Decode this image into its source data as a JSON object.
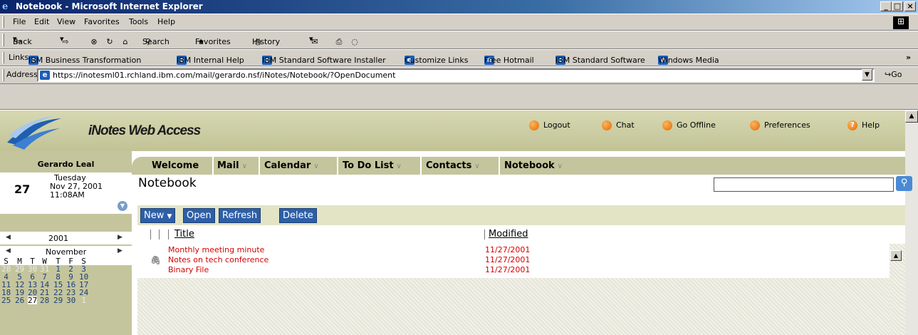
{
  "window": {
    "title": "Notebook - Microsoft Internet Explorer",
    "controls": [
      "_",
      "□",
      "×"
    ]
  },
  "menu": [
    "File",
    "Edit",
    "View",
    "Favorites",
    "Tools",
    "Help"
  ],
  "toolbar": {
    "back": "Back",
    "search": "Search",
    "favorites": "Favorites",
    "history": "History"
  },
  "links": {
    "label": "Links",
    "items": [
      "IBM Business Transformation",
      "IBM Internal Help",
      "IBM Standard Software Installer",
      "Customize Links",
      "Free Hotmail",
      "IBM Standard Software",
      "Windows Media"
    ],
    "more": "»"
  },
  "address": {
    "label": "Address",
    "url": "https://inotesml01.rchland.ibm.com/mail/gerardo.nsf/iNotes/Notebook/?OpenDocument",
    "go": "Go"
  },
  "banner": {
    "app_name": "iNotes Web Access",
    "nav": [
      "Logout",
      "Chat",
      "Go Offline",
      "Preferences",
      "Help"
    ]
  },
  "user": {
    "name": "Gerardo Leal",
    "day_num": "27",
    "weekday": "Tuesday",
    "date": "Nov 27, 2001",
    "time": "11:08AM"
  },
  "calendar": {
    "year": "2001",
    "month": "November",
    "weekdays": [
      "S",
      "M",
      "T",
      "W",
      "T",
      "F",
      "S"
    ],
    "weeks": [
      [
        "28",
        "29",
        "30",
        "31",
        "1",
        "2",
        "3"
      ],
      [
        "4",
        "5",
        "6",
        "7",
        "8",
        "9",
        "10"
      ],
      [
        "11",
        "12",
        "13",
        "14",
        "15",
        "16",
        "17"
      ],
      [
        "18",
        "19",
        "20",
        "21",
        "22",
        "23",
        "24"
      ],
      [
        "25",
        "26",
        "27",
        "28",
        "29",
        "30",
        "1"
      ]
    ],
    "today": "27",
    "colors": {
      "other_month": "#e8e8e8",
      "current_month": "#1c3f7a",
      "today_bg": "#ffffff"
    }
  },
  "tabs": [
    "Welcome",
    "Mail",
    "Calendar",
    "To Do List",
    "Contacts",
    "Notebook"
  ],
  "page": {
    "title": "Notebook",
    "search_placeholder": ""
  },
  "actions": [
    "New",
    "Open",
    "Refresh",
    "Delete"
  ],
  "columns": {
    "title": "Title",
    "modified": "Modified"
  },
  "documents": [
    {
      "title": "Monthly meeting minute",
      "modified": "11/27/2001",
      "attachment": false
    },
    {
      "title": "Notes on tech conference",
      "modified": "11/27/2001",
      "attachment": true
    },
    {
      "title": "Binary File",
      "modified": "11/27/2001",
      "attachment": false
    }
  ],
  "colors": {
    "accent_blue": "#2d5fa8",
    "banner_olive": "#c4c59d",
    "link_red": "#d40000",
    "title_bar": "#0a246a"
  }
}
